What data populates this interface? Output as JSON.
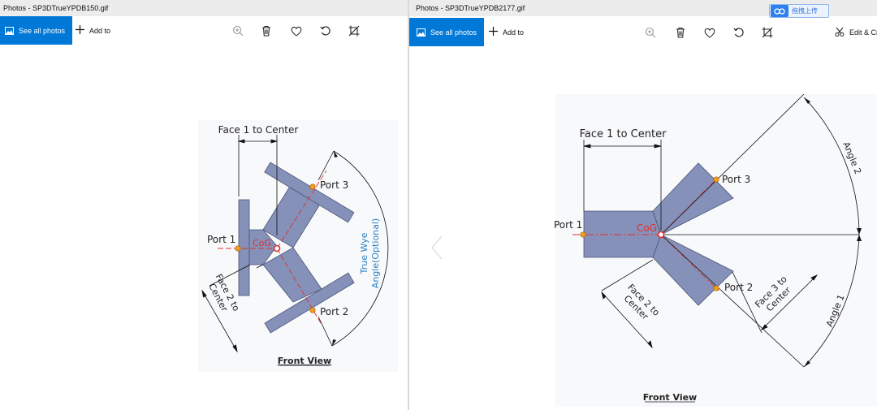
{
  "left_window": {
    "title": "Photos - SP3DTrueYPDB150.gif",
    "see_all_label": "See all photos",
    "add_to_label": "Add to",
    "image": {
      "face1_label": "Face 1 to Center",
      "port1": "Port 1",
      "port2": "Port 2",
      "port3": "Port 3",
      "cog": "CoG",
      "face2_line1": "Face 2 to",
      "face2_line2": "Center",
      "angle_line1": "True Wye",
      "angle_line2": "Angle(Optional)",
      "view_caption": "Front View"
    }
  },
  "right_window": {
    "title": "Photos - SP3DTrueYPDB2177.gif",
    "see_all_label": "See all photos",
    "add_to_label": "Add to",
    "edit_create_label": "Edit & Cr",
    "upload_badge_label": "拖拽上传",
    "image": {
      "face1_label": "Face 1 to Center",
      "port1": "Port 1",
      "port2": "Port 2",
      "port3": "Port 3",
      "cog": "CoG",
      "face2_line1": "Face 2 to",
      "face2_line2": "Center",
      "face3_line1": "Face 3 to",
      "face3_line2": "Center",
      "angle1": "Angle 1",
      "angle2": "Angle 2",
      "view_caption": "Front View"
    }
  },
  "colors": {
    "accent": "#0078d7",
    "pipe_fill": "#8591b8",
    "centerline": "#e03030",
    "angle_text": "#2a7fc1"
  }
}
